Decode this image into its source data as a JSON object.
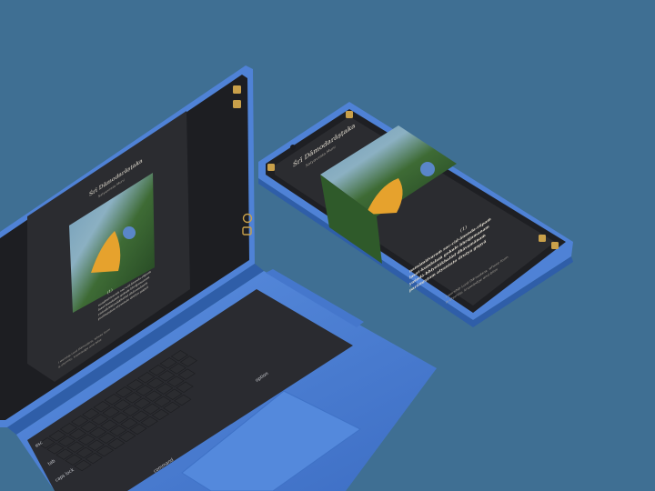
{
  "background_color": "#3f6f93",
  "device_color": "#4f82d6",
  "reader": {
    "title": "Śrī Dāmodarāṣṭaka",
    "subtitle": "Satyavrata Muni",
    "verse_number": "(1)",
    "verse_lines": [
      "namāmīśvaraṁ sac-cid-ānanda-rūpaṁ",
      "lasat-kuṇḍalaṁ gokule bhrājamanam",
      "yaśodā-bhiyolūkhalād dhāvamānaṁ",
      "parāmṛṣṭam atyantato drutya gopyā"
    ],
    "translation_lines": [
      "I worship Lord Dāmodara, whose form",
      "is eternity, knowledge and bliss"
    ],
    "accent_color": "#c9a04a"
  },
  "toolbar_icons": [
    "menu-icon",
    "bookmark-icon",
    "zoom-icon",
    "share-icon"
  ],
  "keyboard": {
    "labels": {
      "esc": "esc",
      "tab": "tab",
      "caps": "caps lock",
      "shift": "shift",
      "control": "control",
      "option": "option",
      "command": "command",
      "fn": "fn"
    }
  }
}
